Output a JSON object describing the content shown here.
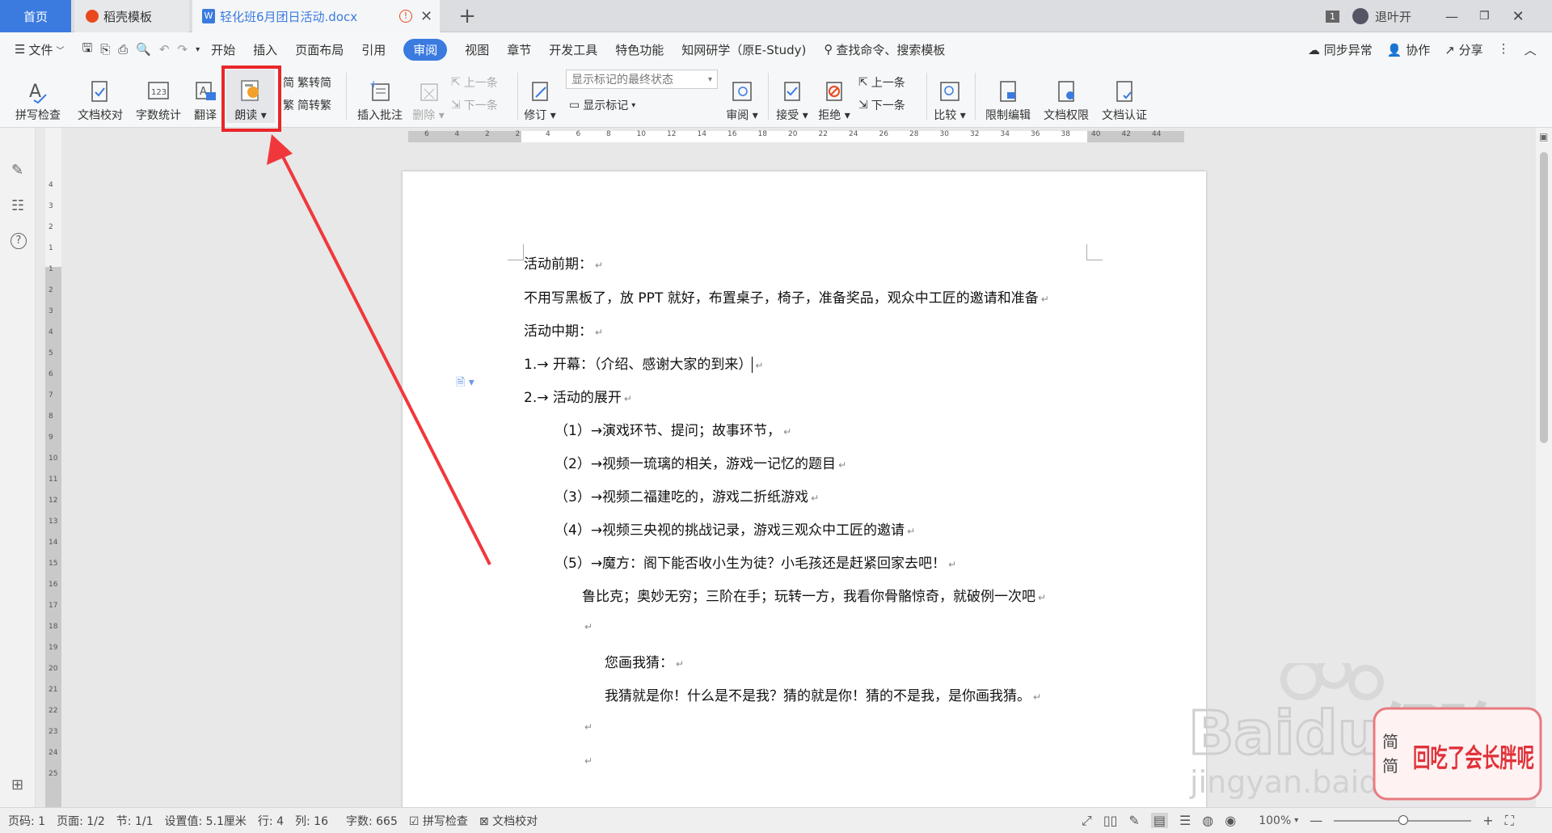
{
  "tabs": {
    "home": "首页",
    "templates": "稻壳模板",
    "doc": "轻化班6月团日活动.docx",
    "badge": "1",
    "user": "退叶开"
  },
  "menu": {
    "file": "文件",
    "items": [
      "开始",
      "插入",
      "页面布局",
      "引用",
      "审阅",
      "视图",
      "章节",
      "开发工具",
      "特色功能",
      "知网研学（原E-Study)"
    ],
    "active_index": 4,
    "search": "查找命令、搜索模板",
    "sync": "同步异常",
    "collab": "协作",
    "share": "分享"
  },
  "ribbon": {
    "spellcheck": "拼写检查",
    "doccheck": "文档校对",
    "wordcount": "字数统计",
    "translate": "翻译",
    "read": "朗读",
    "trad2simp": "繁转简",
    "simp2trad": "简转繁",
    "insert_comment": "插入批注",
    "delete": "删除",
    "prev_comment": "上一条",
    "next_comment": "下一条",
    "track": "修订",
    "markup_select": "显示标记的最终状态",
    "show_markup": "显示标记",
    "review": "审阅",
    "accept": "接受",
    "reject": "拒绝",
    "prev": "上一条",
    "next": "下一条",
    "compare": "比较",
    "restrict": "限制编辑",
    "permission": "文档权限",
    "certify": "文档认证"
  },
  "ruler_h": [
    "6",
    "4",
    "2",
    "2",
    "4",
    "6",
    "8",
    "10",
    "12",
    "14",
    "16",
    "18",
    "20",
    "22",
    "24",
    "26",
    "28",
    "30",
    "32",
    "34",
    "36",
    "38",
    "40",
    "42",
    "44"
  ],
  "ruler_v": [
    "4",
    "3",
    "2",
    "1",
    "1",
    "2",
    "3",
    "4",
    "5",
    "6",
    "7",
    "8",
    "9",
    "10",
    "11",
    "12",
    "13",
    "14",
    "15",
    "16",
    "17",
    "18",
    "19",
    "20",
    "21",
    "22",
    "23",
    "24",
    "25"
  ],
  "document": {
    "l1": "活动前期：",
    "l2": "不用写黑板了，放 PPT 就好，布置桌子，椅子，准备奖品，观众中工匠的邀请和准备",
    "l3": "活动中期：",
    "l4": "1.→ 开幕：（介绍、感谢大家的到来）",
    "l5": "2.→ 活动的展开",
    "l6": "（1）→演戏环节、提问；故事环节，",
    "l7": "（2）→视频一琉璃的相关，游戏一记忆的题目",
    "l8": "（3）→视频二福建吃的，游戏二折纸游戏",
    "l9": "（4）→视频三央视的挑战记录，游戏三观众中工匠的邀请",
    "l10": "（5）→魔方：阁下能否收小生为徒？小毛孩还是赶紧回家去吧！",
    "l11": "鲁比克；奥妙无穷；三阶在手；玩转一方，我看你骨骼惊奇，就破例一次吧",
    "l12": "您画我猜：",
    "l13": "我猜就是你！什么是不是我？猜的就是你！猜的不是我，是你画我猜。"
  },
  "status": {
    "page_num": "页码: 1",
    "page": "页面: 1/2",
    "section": "节: 1/1",
    "setting": "设置值: 5.1厘米",
    "row": "行: 4",
    "col": "列: 16",
    "words": "字数: 665",
    "spell": "拼写检查",
    "proof": "文档校对",
    "zoom": "100%"
  },
  "watermark": {
    "brand": "Baidu经验",
    "url": "jingyan.baidu.com",
    "sticker": "回吃了会长胖呢",
    "note_a": "简",
    "note_b": "简"
  },
  "colors": {
    "accent": "#3b7be0",
    "highlight": "#e8262a",
    "wps_orange": "#e84a1e"
  }
}
